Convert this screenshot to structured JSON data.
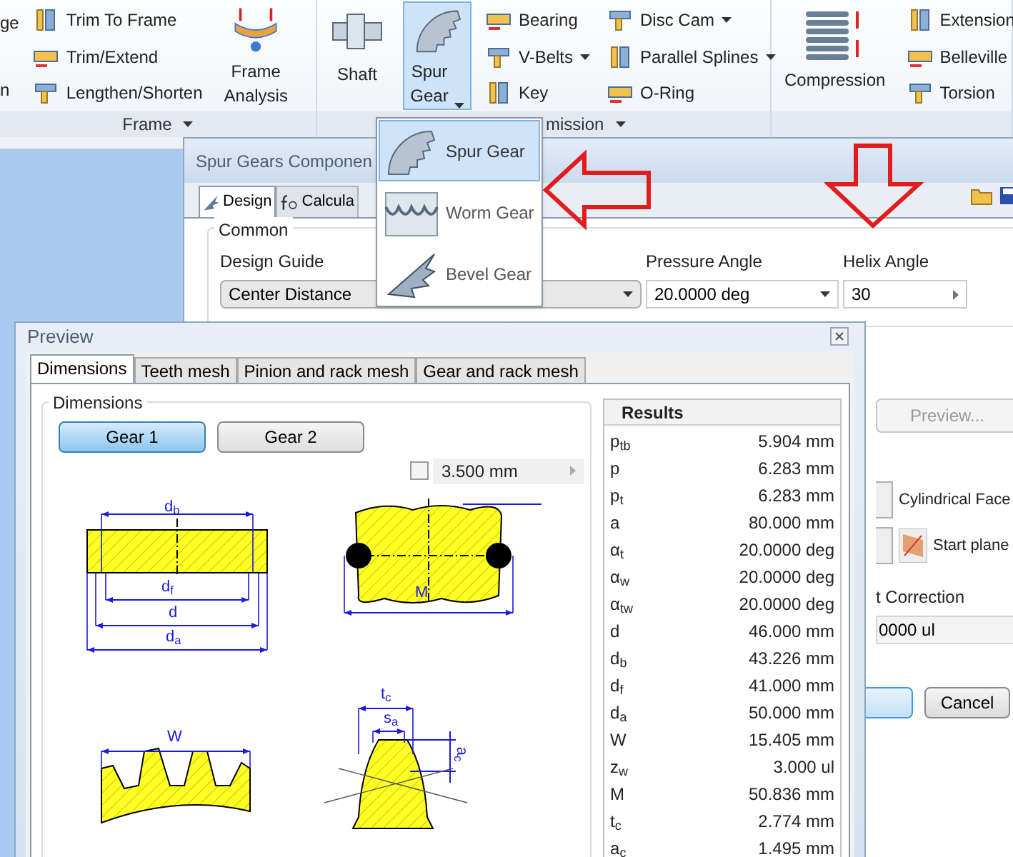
{
  "ribbon": {
    "panels": [
      {
        "label": "Frame",
        "menu": true,
        "columns": [
          {
            "kind": "cut",
            "items": [
              {
                "label": "ge"
              },
              {
                "label": "n"
              }
            ]
          },
          {
            "kind": "small",
            "items": [
              {
                "label": "Trim To Frame",
                "menu": false
              },
              {
                "label": "Trim/Extend",
                "menu": false
              },
              {
                "label": "Lengthen/Shorten",
                "menu": false
              }
            ]
          },
          {
            "kind": "large",
            "label": "Frame Analysis",
            "selected": false,
            "menu": false
          }
        ]
      },
      {
        "label": "mission",
        "menu": true,
        "columns": [
          {
            "kind": "large",
            "label": "Shaft",
            "selected": false,
            "menu": false
          },
          {
            "kind": "large",
            "label": "Spur Gear",
            "selected": true,
            "menu": true
          },
          {
            "kind": "small",
            "items": [
              {
                "label": "Bearing",
                "menu": false
              },
              {
                "label": "V-Belts",
                "menu": true
              },
              {
                "label": "Key",
                "menu": false
              }
            ]
          },
          {
            "kind": "small",
            "items": [
              {
                "label": "Disc Cam",
                "menu": true
              },
              {
                "label": "Parallel Splines",
                "menu": true
              },
              {
                "label": "O-Ring",
                "menu": false
              }
            ]
          }
        ]
      },
      {
        "columns": [
          {
            "kind": "large",
            "label": "Compression",
            "selected": false,
            "menu": false
          },
          {
            "kind": "small",
            "items": [
              {
                "label": "Extension"
              },
              {
                "label": "Belleville"
              },
              {
                "label": "Torsion"
              }
            ]
          }
        ]
      }
    ]
  },
  "gear_menu": [
    {
      "label": "Spur Gear",
      "selected": true
    },
    {
      "label": "Worm Gear",
      "selected": false
    },
    {
      "label": "Bevel Gear",
      "selected": false
    }
  ],
  "dialog": {
    "title": "Spur Gears Componen",
    "tabs": [
      {
        "label": "Design",
        "selected": true
      },
      {
        "label": "Calcula",
        "selected": false
      }
    ],
    "group": "Common",
    "fields": [
      {
        "label": "Design Guide",
        "kind": "select",
        "value": "Center Distance"
      },
      {
        "label": "Pressure Angle",
        "kind": "select",
        "value": "20.0000 deg"
      },
      {
        "label": "Helix Angle",
        "kind": "spin",
        "value": "30"
      }
    ],
    "preview_button": {
      "label": "Preview...",
      "disabled": true
    },
    "placements": [
      "Cylindrical Face",
      "Start plane"
    ],
    "correction_label": "t Correction",
    "correction_value": "0000 ul",
    "cancel": "Cancel"
  },
  "preview": {
    "title": "Preview",
    "tabs": [
      {
        "label": "Dimensions",
        "selected": true
      },
      {
        "label": "Teeth mesh",
        "selected": false
      },
      {
        "label": "Pinion and rack mesh",
        "selected": false
      },
      {
        "label": "Gear and rack mesh",
        "selected": false
      }
    ],
    "group": "Dimensions",
    "gears": [
      {
        "label": "Gear 1",
        "selected": true
      },
      {
        "label": "Gear 2",
        "selected": false
      }
    ],
    "ball": {
      "checked": false,
      "value": "3.500 mm"
    },
    "drawings": [
      {
        "kind": "gear-section",
        "labels": [
          "d$_{b}$",
          "d$_{f}$",
          "d",
          "d$_{a}$"
        ]
      },
      {
        "kind": "ball-measure",
        "labels": [
          "M"
        ]
      },
      {
        "kind": "span-measure",
        "labels": [
          "W"
        ]
      },
      {
        "kind": "tooth-chord",
        "labels": [
          "t$_{c}$",
          "s$_{a}$",
          "a$_{c}$"
        ]
      }
    ],
    "results_title": "Results",
    "results": [
      {
        "name": "p$_{tb}$",
        "value": "5.904 mm"
      },
      {
        "name": "p",
        "value": "6.283 mm"
      },
      {
        "name": "p$_{t}$",
        "value": "6.283 mm"
      },
      {
        "name": "a",
        "value": "80.000 mm"
      },
      {
        "name": "α$_{t}$",
        "value": "20.0000 deg"
      },
      {
        "name": "α$_{w}$",
        "value": "20.0000 deg"
      },
      {
        "name": "α$_{tw}$",
        "value": "20.0000 deg"
      },
      {
        "name": "d",
        "value": "46.000 mm"
      },
      {
        "name": "d$_{b}$",
        "value": "43.226 mm"
      },
      {
        "name": "d$_{f}$",
        "value": "41.000 mm"
      },
      {
        "name": "d$_{a}$",
        "value": "50.000 mm"
      },
      {
        "name": "W",
        "value": "15.405 mm"
      },
      {
        "name": "z$_{w}$",
        "value": "3.000 ul"
      },
      {
        "name": "M",
        "value": "50.836 mm"
      },
      {
        "name": "t$_{c}$",
        "value": "2.774 mm"
      },
      {
        "name": "a$_{c}$",
        "value": "1.495 mm"
      }
    ]
  }
}
